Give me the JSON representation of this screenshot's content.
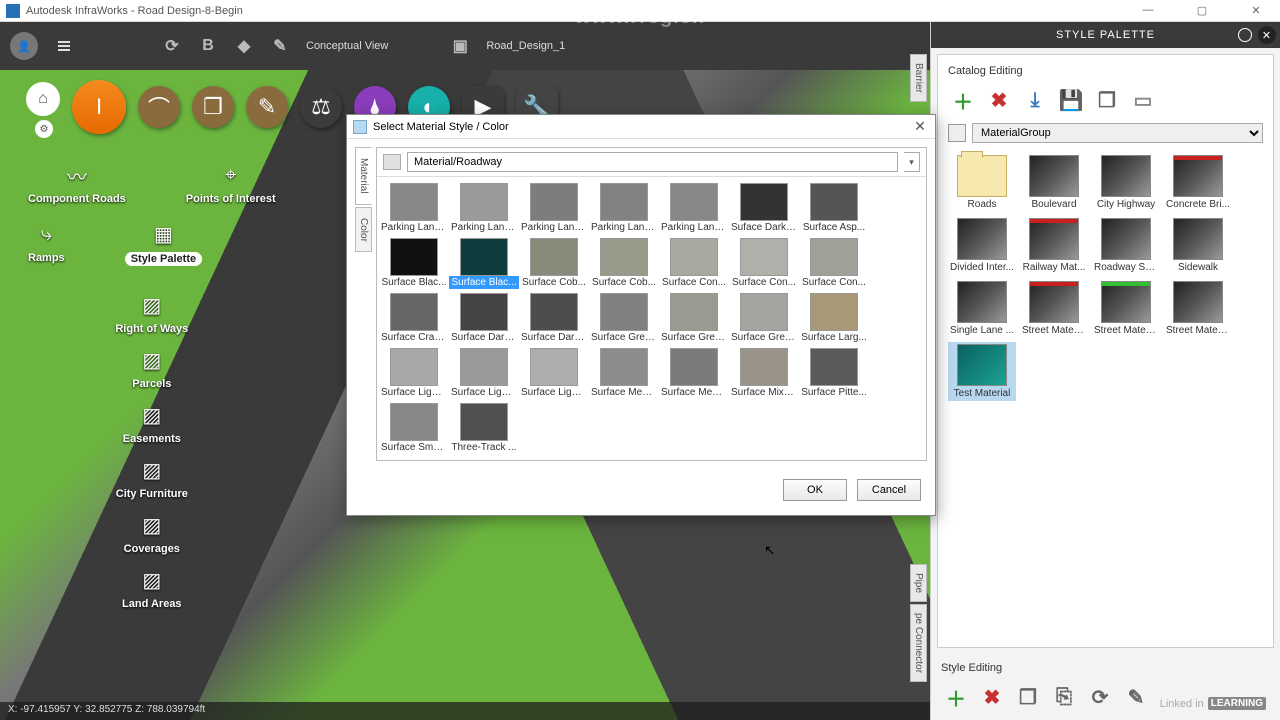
{
  "app": {
    "title": "Autodesk InfraWorks  - Road Design-8-Begin"
  },
  "watermark": "www.rrcg.cn",
  "win": {
    "min": "—",
    "max": "▢",
    "close": "✕"
  },
  "topbar": {
    "view_label": "Conceptual View",
    "design_label": "Road_Design_1"
  },
  "left_tools": {
    "row1": [
      {
        "id": "component-roads",
        "label": "Component Roads"
      },
      {
        "id": "points-of-interest",
        "label": "Points of Interest"
      }
    ],
    "row2": [
      {
        "id": "ramps",
        "label": "Ramps"
      },
      {
        "id": "style-palette",
        "label": "Style Palette",
        "active": true
      }
    ],
    "col": [
      {
        "id": "right-of-ways",
        "label": "Right of Ways"
      },
      {
        "id": "parcels",
        "label": "Parcels"
      },
      {
        "id": "easements",
        "label": "Easements"
      },
      {
        "id": "city-furniture",
        "label": "City Furniture"
      },
      {
        "id": "coverages",
        "label": "Coverages"
      },
      {
        "id": "land-areas",
        "label": "Land Areas"
      }
    ]
  },
  "coords": "X: -97.415957 Y: 32.852775 Z: 788.039794ft",
  "dialog": {
    "title": "Select Material Style / Color",
    "tabs": {
      "material": "Material",
      "color": "Color"
    },
    "path": "Material/Roadway",
    "ok": "OK",
    "cancel": "Cancel",
    "items": [
      {
        "label": "Parking Lane...",
        "color": "#888"
      },
      {
        "label": "Parking Lane...",
        "color": "#9a9a9a"
      },
      {
        "label": "Parking Lane...",
        "color": "#7d7d7d"
      },
      {
        "label": "Parking Lane...",
        "color": "#828282"
      },
      {
        "label": "Parking Lane...",
        "color": "#888"
      },
      {
        "label": "Suface Dark ...",
        "color": "#333"
      },
      {
        "label": "Surface Asp...",
        "color": "#555"
      },
      {
        "label": "Surface Blac...",
        "color": "#111"
      },
      {
        "label": "Surface Blac...",
        "color": "#0d3d3d",
        "sel": true
      },
      {
        "label": "Surface Cob...",
        "color": "#8a8a7a"
      },
      {
        "label": "Surface Cob...",
        "color": "#9a9a8a"
      },
      {
        "label": "Surface Con...",
        "color": "#a8a8a0"
      },
      {
        "label": "Surface Con...",
        "color": "#b0b0aa"
      },
      {
        "label": "Surface Con...",
        "color": "#a0a098"
      },
      {
        "label": "Surface Crac...",
        "color": "#666"
      },
      {
        "label": "Surface Dark...",
        "color": "#444"
      },
      {
        "label": "Surface Dark...",
        "color": "#4d4d4d"
      },
      {
        "label": "Surface Grey...",
        "color": "#808080"
      },
      {
        "label": "Surface Grey...",
        "color": "#9a9a90"
      },
      {
        "label": "Surface Grey...",
        "color": "#a4a4a0"
      },
      {
        "label": "Surface Larg...",
        "color": "#a89878"
      },
      {
        "label": "Surface Light...",
        "color": "#a8a8a8"
      },
      {
        "label": "Surface Light...",
        "color": "#9a9a9a"
      },
      {
        "label": "Surface Light...",
        "color": "#adadad"
      },
      {
        "label": "Surface Med ...",
        "color": "#8c8c8c"
      },
      {
        "label": "Surface Med ...",
        "color": "#7a7a7a"
      },
      {
        "label": "Surface Mixe...",
        "color": "#9a9488"
      },
      {
        "label": "Surface Pitte...",
        "color": "#5a5a5a"
      },
      {
        "label": "Surface Smo...",
        "color": "#888"
      },
      {
        "label": "Three-Track ...",
        "color": "#505050"
      }
    ]
  },
  "palette": {
    "title": "STYLE PALETTE",
    "catalog_editing": "Catalog Editing",
    "style_editing": "Style Editing",
    "group": "MaterialGroup",
    "vtabs": {
      "barrier": "Barrier",
      "pipe": "Pipe",
      "pipe_connector": "pe Connector"
    },
    "items": [
      {
        "label": "Roads",
        "type": "folder"
      },
      {
        "label": "Boulevard",
        "top": ""
      },
      {
        "label": "City Highway",
        "top": ""
      },
      {
        "label": "Concrete Bri...",
        "top": "red"
      },
      {
        "label": "Divided Inter...",
        "top": ""
      },
      {
        "label": "Railway Mat...",
        "top": "red"
      },
      {
        "label": "Roadway Su...",
        "top": ""
      },
      {
        "label": "Sidewalk",
        "top": ""
      },
      {
        "label": "Single Lane ...",
        "top": ""
      },
      {
        "label": "Street Materi...",
        "top": "red"
      },
      {
        "label": "Street Materi...",
        "top": "green"
      },
      {
        "label": "Street Materi...",
        "top": ""
      },
      {
        "label": "Test Material",
        "type": "teal",
        "sel": true
      }
    ]
  },
  "linkedin": {
    "brand": "Linked in",
    "sub": "LEARNING"
  }
}
